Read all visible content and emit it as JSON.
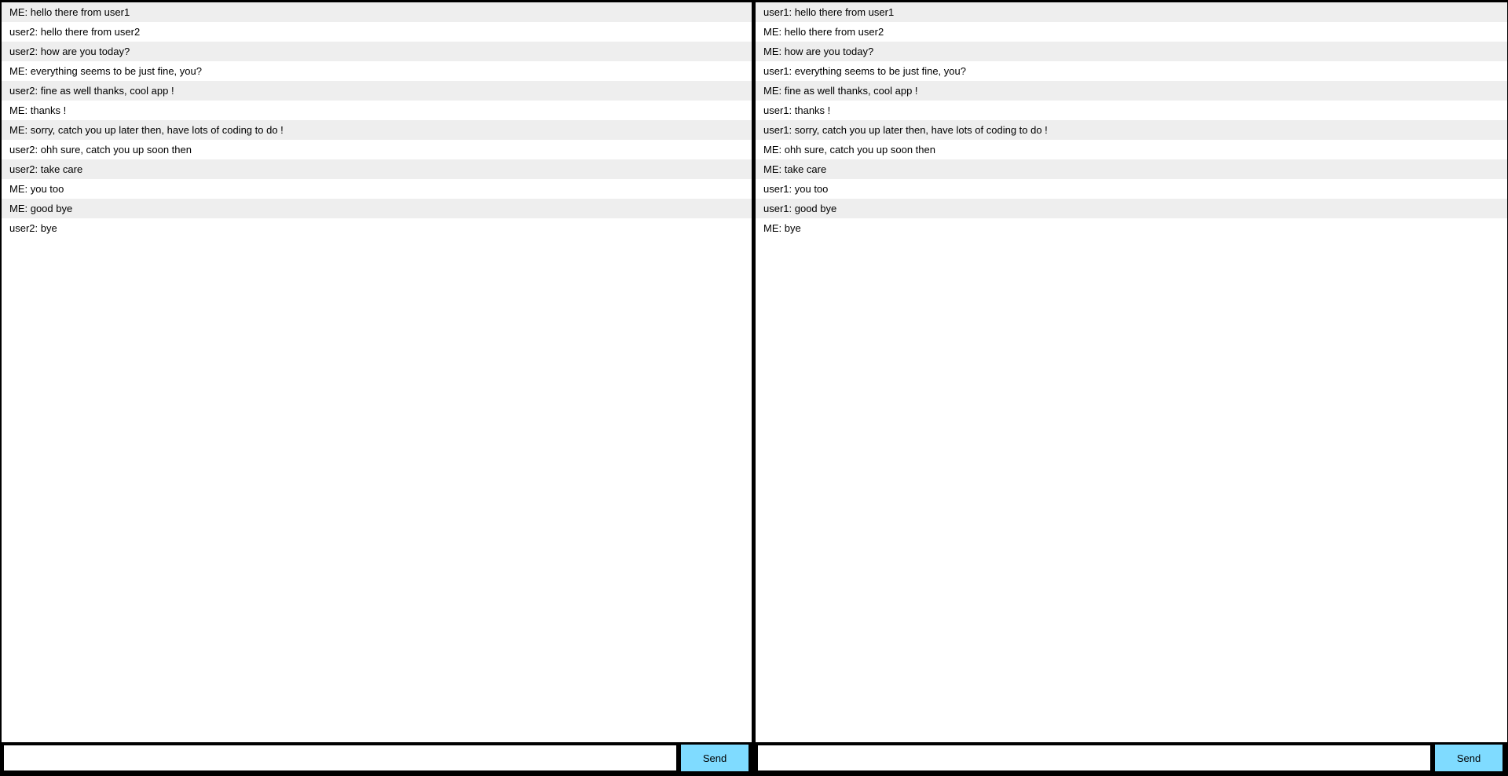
{
  "colors": {
    "frame": "#000000",
    "stripe": "#eeeeee",
    "send_button": "#7fdbff"
  },
  "left_chat": {
    "messages": [
      "ME: hello there from user1",
      "user2: hello there from user2",
      "user2: how are you today?",
      "ME: everything seems to be just fine, you?",
      "user2: fine as well thanks, cool app !",
      "ME: thanks !",
      "ME: sorry, catch you up later then, have lots of coding to do !",
      "user2: ohh sure, catch you up soon then",
      "user2: take care",
      "ME: you too",
      "ME: good bye",
      "user2: bye"
    ],
    "input_value": "",
    "send_label": "Send"
  },
  "right_chat": {
    "messages": [
      "user1: hello there from user1",
      "ME: hello there from user2",
      "ME: how are you today?",
      "user1: everything seems to be just fine, you?",
      "ME: fine as well thanks, cool app !",
      "user1: thanks !",
      "user1: sorry, catch you up later then, have lots of coding to do !",
      "ME: ohh sure, catch you up soon then",
      "ME: take care",
      "user1: you too",
      "user1: good bye",
      "ME: bye"
    ],
    "input_value": "",
    "send_label": "Send"
  }
}
